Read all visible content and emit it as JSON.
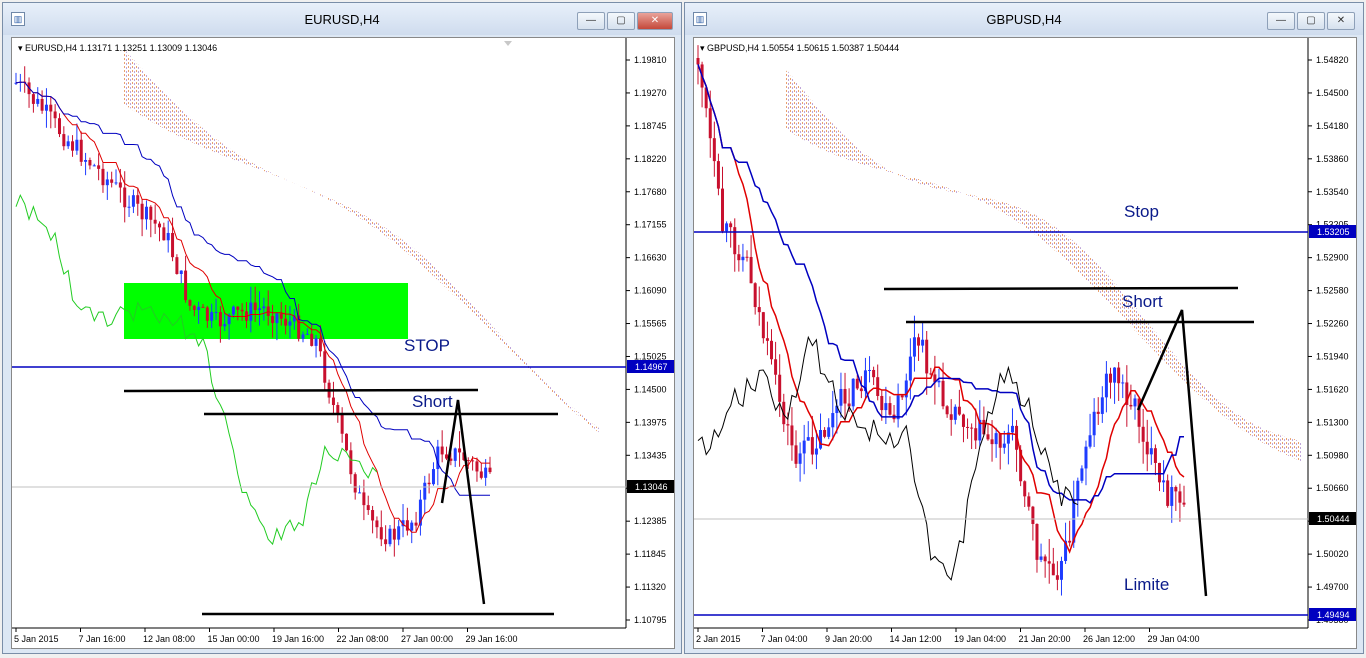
{
  "windows": [
    {
      "title": "EURUSD,H4",
      "header": "EURUSD,H4  1.13171 1.13251 1.13009 1.13046",
      "price_labels": [
        "1.19810",
        "1.19270",
        "1.18745",
        "1.18220",
        "1.17680",
        "1.17155",
        "1.16630",
        "1.16090",
        "1.15565",
        "1.15025",
        "1.14500",
        "1.13975",
        "1.13435",
        "1.12910",
        "1.12385",
        "1.11845",
        "1.11320",
        "1.10795"
      ],
      "current_price": "1.13046",
      "line_price": "1.14967",
      "time_labels": [
        "5 Jan 2015",
        "7 Jan 16:00",
        "12 Jan 08:00",
        "15 Jan 00:00",
        "19 Jan 16:00",
        "22 Jan 08:00",
        "27 Jan 00:00",
        "29 Jan 16:00"
      ],
      "annotations": {
        "stop": "STOP",
        "short": "Short"
      }
    },
    {
      "title": "GBPUSD,H4",
      "header": "GBPUSD,H4  1.50554 1.50615 1.50387 1.50444",
      "price_labels": [
        "1.54820",
        "1.54500",
        "1.54180",
        "1.53860",
        "1.53540",
        "1.53205",
        "1.52900",
        "1.52580",
        "1.52260",
        "1.51940",
        "1.51620",
        "1.51300",
        "1.50980",
        "1.50660",
        "1.50340",
        "1.50020",
        "1.49700",
        "1.49380"
      ],
      "current_price": "1.50444",
      "line_price_top": "1.53205",
      "line_price_bottom": "1.49494",
      "time_labels": [
        "2 Jan 2015",
        "7 Jan 04:00",
        "9 Jan 20:00",
        "14 Jan 12:00",
        "19 Jan 04:00",
        "21 Jan 20:00",
        "26 Jan 12:00",
        "29 Jan 04:00"
      ],
      "annotations": {
        "stop": "Stop",
        "short": "Short",
        "limit": "Limite"
      }
    }
  ],
  "colors": {
    "bull": "#1e3cff",
    "bear": "#c8102e",
    "kijun": "#0000c0",
    "tenkan": "#e00000",
    "chikou_eur": "#22cc22",
    "chikou_gbp": "#000000",
    "cloud_a": "#e8a070",
    "cloud_b": "#b090d0",
    "zone": "#00ff00",
    "hline": "#0000c0",
    "label_bg": "#0000c0"
  }
}
